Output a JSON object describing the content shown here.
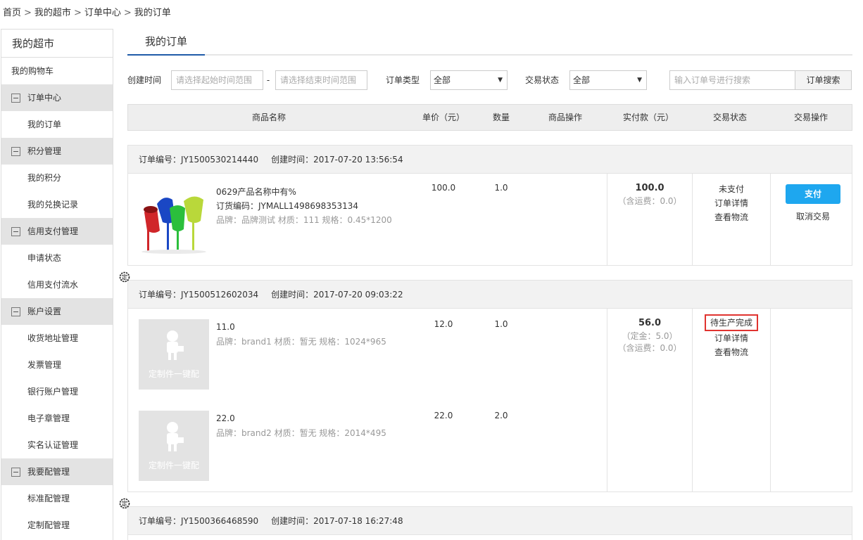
{
  "breadcrumb": [
    "首页",
    "我的超市",
    "订单中心",
    "我的订单"
  ],
  "breadcrumb_sep": ">",
  "sidebar": {
    "title": "我的超市",
    "top_item": "我的购物车",
    "groups": [
      {
        "label": "订单中心",
        "items": [
          "我的订单"
        ]
      },
      {
        "label": "积分管理",
        "items": [
          "我的积分",
          "我的兑换记录"
        ]
      },
      {
        "label": "信用支付管理",
        "items": [
          "申请状态",
          "信用支付流水"
        ]
      },
      {
        "label": "账户设置",
        "items": [
          "收货地址管理",
          "发票管理",
          "银行账户管理",
          "电子章管理",
          "实名认证管理"
        ]
      },
      {
        "label": "我要配管理",
        "items": [
          "标准配管理",
          "定制配管理"
        ]
      }
    ]
  },
  "tab": "我的订单",
  "filters": {
    "created_label": "创建时间",
    "start_placeholder": "请选择起始时间范围",
    "dash": "-",
    "end_placeholder": "请选择结束时间范围",
    "type_label": "订单类型",
    "type_value": "全部",
    "status_label": "交易状态",
    "status_value": "全部",
    "search_placeholder": "输入订单号进行搜索",
    "search_button": "订单搜索"
  },
  "table_headers": [
    "商品名称",
    "单价（元）",
    "数量",
    "商品操作",
    "实付款（元）",
    "交易状态",
    "交易操作"
  ],
  "orders": [
    {
      "no_label": "订单编号：JY1500530214440",
      "time_label": "创建时间：2017-07-20 13:56:54",
      "product": {
        "name": "0629产品名称中有%",
        "code": "订货编码：JYMALL1498698353134",
        "attrs": "品牌：品牌测试 材质：111 规格：0.45*1200",
        "price": "100.0",
        "qty": "1.0"
      },
      "pay_amount": "100.0",
      "pay_freight": "（含运费：0.0）",
      "status": "未支付",
      "detail_link": "订单详情",
      "logistics_link": "查看物流",
      "pay_button": "支付",
      "cancel_link": "取消交易"
    },
    {
      "no_label": "订单编号：JY1500512602034",
      "time_label": "创建时间：2017-07-20 09:03:22",
      "products": [
        {
          "name": "11.0",
          "attrs": "品牌：brand1 材质：暂无 规格：1024*965",
          "price": "12.0",
          "qty": "1.0",
          "placeholder": "定制件一键配"
        },
        {
          "name": "22.0",
          "attrs": "品牌：brand2 材质：暂无 规格：2014*495",
          "price": "22.0",
          "qty": "2.0",
          "placeholder": "定制件一键配"
        }
      ],
      "pay_amount": "56.0",
      "pay_deposit": "（定金：5.0）",
      "pay_freight": "（含运费：0.0）",
      "status": "待生产完成",
      "detail_link": "订单详情",
      "logistics_link": "查看物流"
    },
    {
      "no_label": "订单编号：JY1500366468590",
      "time_label": "创建时间：2017-07-18 16:27:48"
    }
  ],
  "colors": {
    "accent": "#1f5ba8",
    "pay_button": "#1ea7ef",
    "highlight": "#e0332f"
  }
}
